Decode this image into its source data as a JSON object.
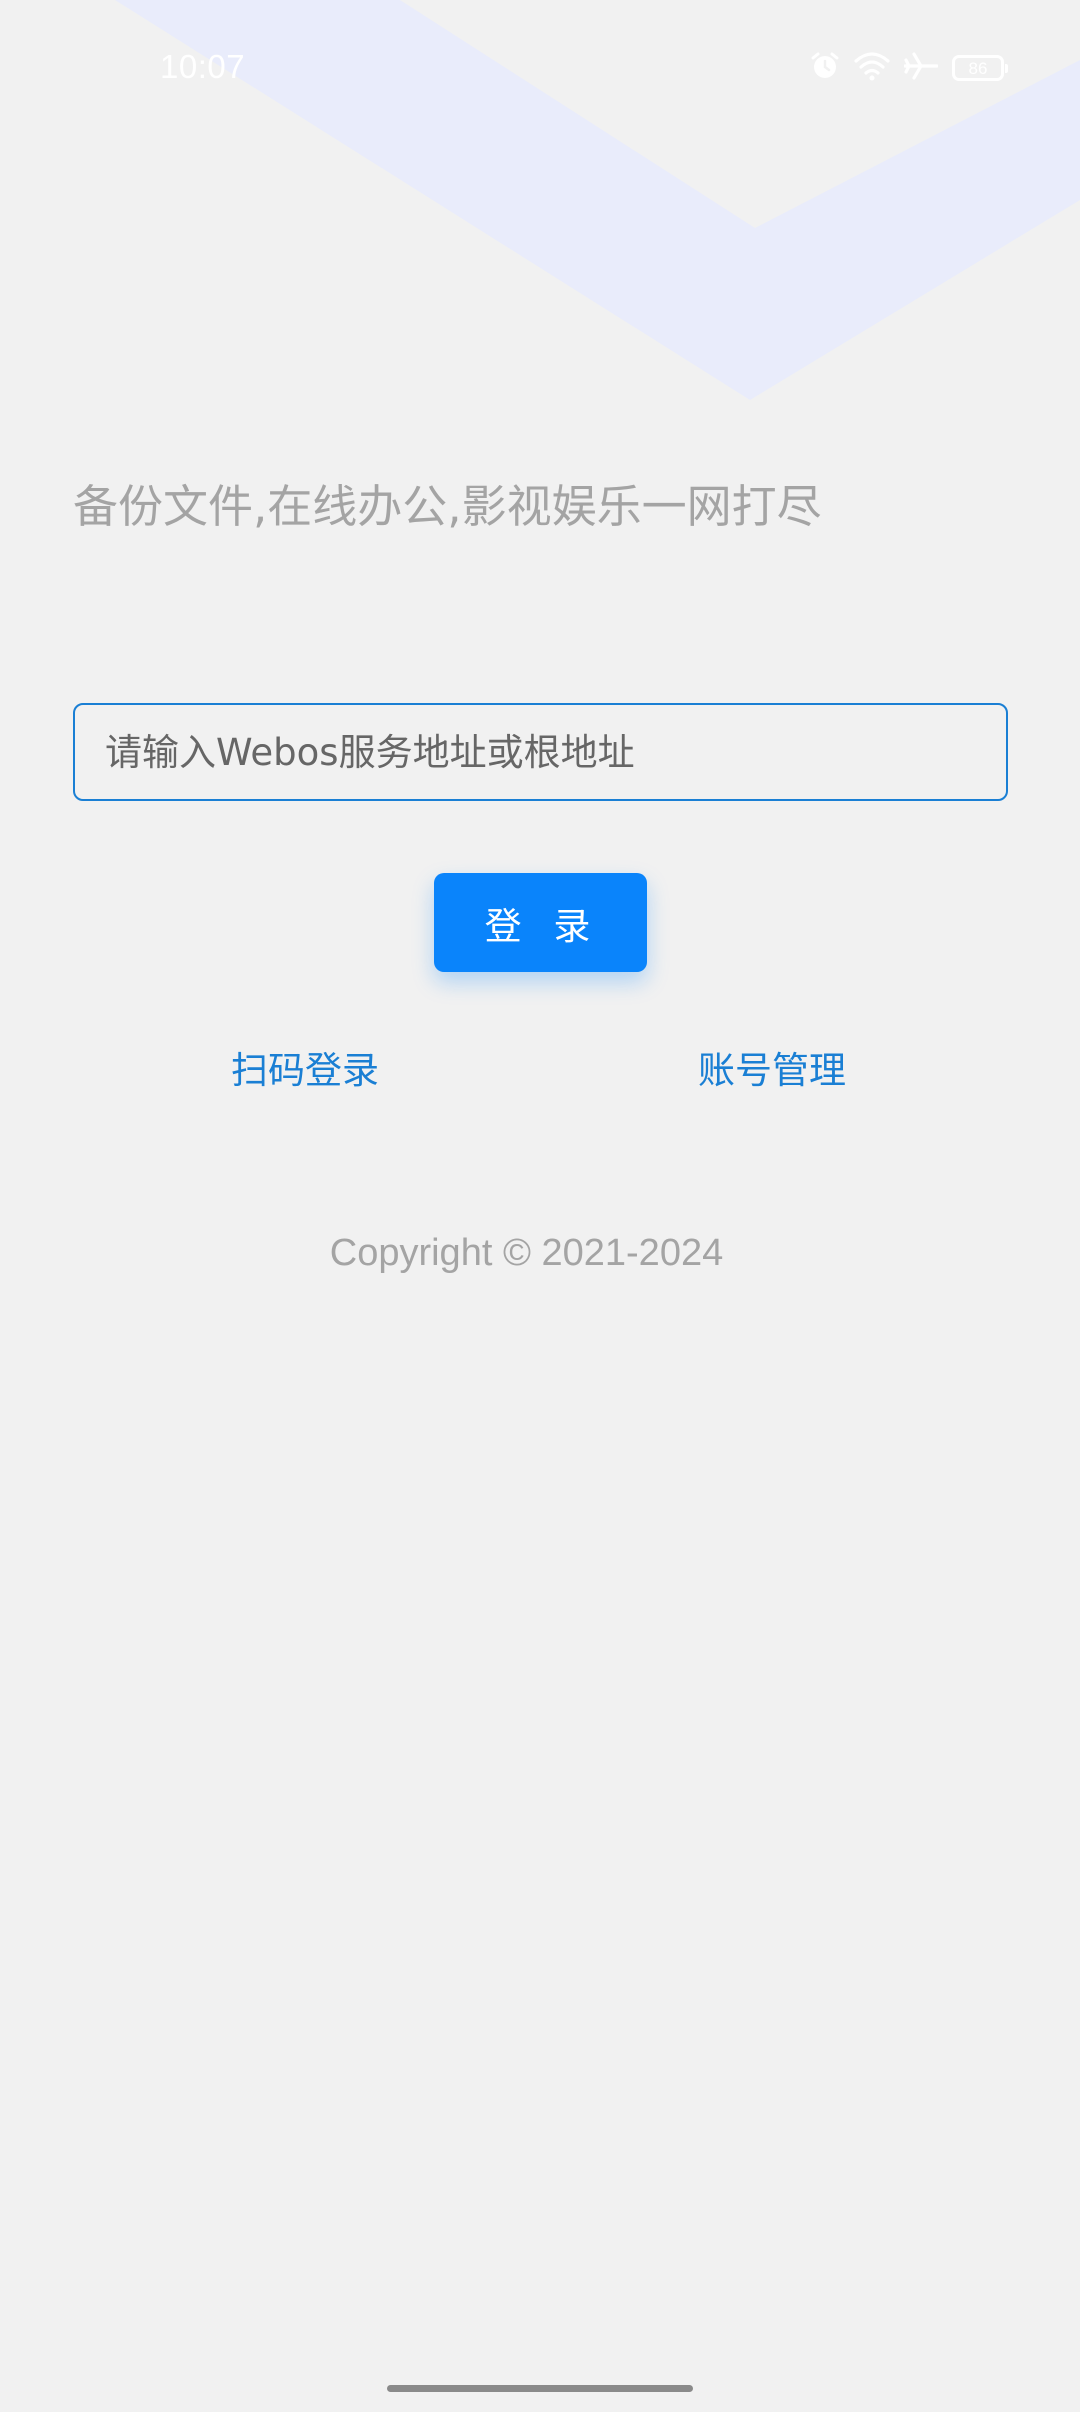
{
  "status_bar": {
    "time": "10:07",
    "battery_level": "86",
    "icons": [
      "alarm-icon",
      "wifi-icon",
      "airplane-icon",
      "battery-icon"
    ]
  },
  "tagline": "备份文件,在线办公,影视娱乐一网打尽",
  "server_input": {
    "value": "",
    "placeholder": "请输入Webos服务地址或根地址"
  },
  "login_button": {
    "label": "登 录"
  },
  "links": {
    "scan_login": "扫码登录",
    "account_manage": "账号管理"
  },
  "footer": {
    "copyright": "Copyright © 2021-2024"
  },
  "colors": {
    "background": "#f1f1f1",
    "accent": "#0a84fb",
    "link": "#1a7fd4",
    "muted_text": "#a4a4a4",
    "decor": "#e9ecfb"
  }
}
